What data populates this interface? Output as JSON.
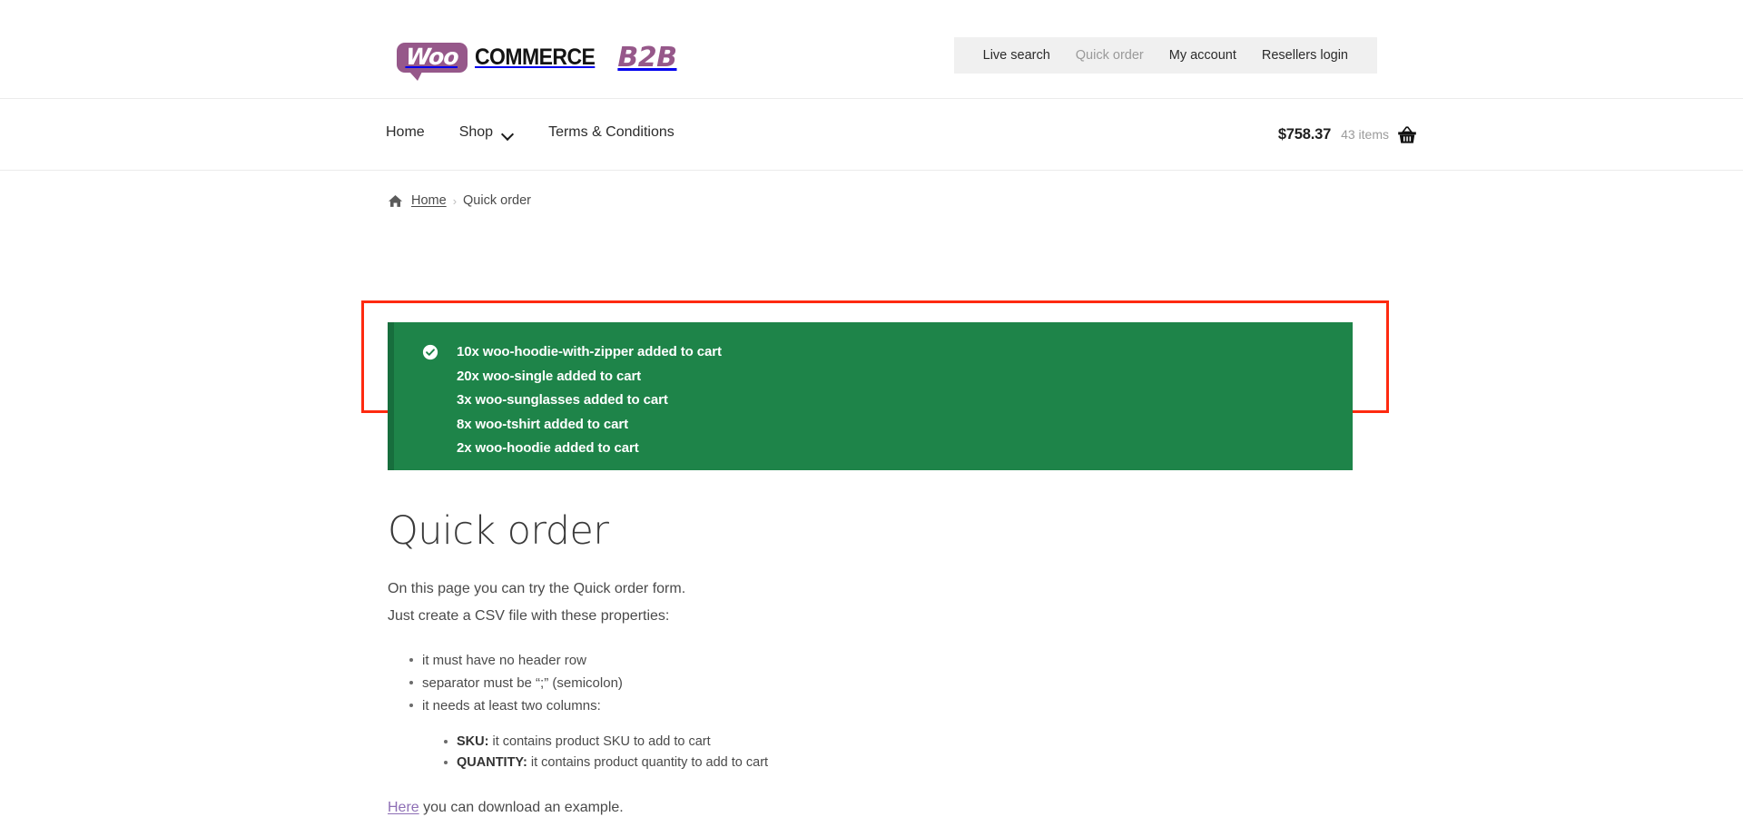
{
  "header": {
    "logo": {
      "woo": "Woo",
      "commerce": "COMMERCE",
      "b2b": "B2B",
      "brand_purple": "#96588a"
    },
    "utility_nav": [
      {
        "label": "Live search",
        "current": false
      },
      {
        "label": "Quick order",
        "current": true
      },
      {
        "label": "My account",
        "current": false
      },
      {
        "label": "Resellers login",
        "current": false
      }
    ],
    "main_nav": [
      {
        "label": "Home",
        "has_dropdown": false
      },
      {
        "label": "Shop",
        "has_dropdown": true
      },
      {
        "label": "Terms & Conditions",
        "has_dropdown": false
      }
    ],
    "cart": {
      "total": "$758.37",
      "items": "43 items",
      "icon": "shopping-basket-icon"
    }
  },
  "breadcrumb": {
    "home_icon": "home-icon",
    "home_label": "Home",
    "separator": "›",
    "current": "Quick order"
  },
  "alert": {
    "type": "success",
    "icon": "check-circle-icon",
    "background": "#1e8449",
    "accent": "#176e3d",
    "lines": [
      "10x woo-hoodie-with-zipper added to cart",
      "20x woo-single added to cart",
      "3x woo-sunglasses added to cart",
      "8x woo-tshirt added to cart",
      "2x woo-hoodie added to cart"
    ]
  },
  "annotation": {
    "color": "#fe2a10"
  },
  "main": {
    "title": "Quick order",
    "intro_line_1": "On this page you can try the Quick order form.",
    "intro_line_2": "Just create a CSV file with these properties:",
    "bullets": [
      "it must have no header row",
      "separator must be “;” (semicolon)",
      "it needs at least two columns:"
    ],
    "sub_bullets": [
      {
        "label": "SKU:",
        "text": " it contains product SKU to add to cart"
      },
      {
        "label": "QUANTITY:",
        "text": " it contains product quantity to add to cart"
      }
    ],
    "download": {
      "link_label": "Here",
      "rest": " you can download an example.",
      "link_color": "#8e6fb5"
    }
  }
}
